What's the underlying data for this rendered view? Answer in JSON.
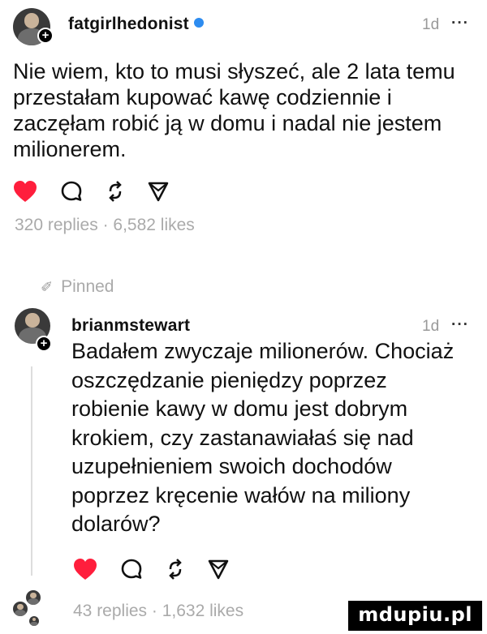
{
  "post": {
    "username": "fatgirlhedonist",
    "time": "1d",
    "more": "···",
    "text": "Nie wiem, kto to musi słyszeć, ale 2 lata temu przestałam kupować kawę codziennie i zaczęłam robić ją w domu i nadal nie jestem milionerem.",
    "stats": "320 replies · 6,582 likes"
  },
  "pinned_label": "Pinned",
  "reply": {
    "username": "brianmstewart",
    "time": "1d",
    "more": "···",
    "text": "Badałem zwyczaje milionerów. Chociaż oszczędzanie pieniędzy poprzez robienie kawy w domu jest dobrym krokiem, czy zastanawiałaś się nad uzupełnieniem swoich dochodów poprzez kręcenie wałów na miliony dolarów?",
    "stats": "43 replies · 1,632 likes"
  },
  "watermark": "mdupiu.pl",
  "colors": {
    "like": "#ff1e3c",
    "muted": "#aaaaaa",
    "text": "#111111"
  },
  "icons": [
    "heart-icon",
    "comment-icon",
    "repost-icon",
    "send-icon",
    "pin-icon",
    "plus-icon",
    "verified-icon"
  ]
}
